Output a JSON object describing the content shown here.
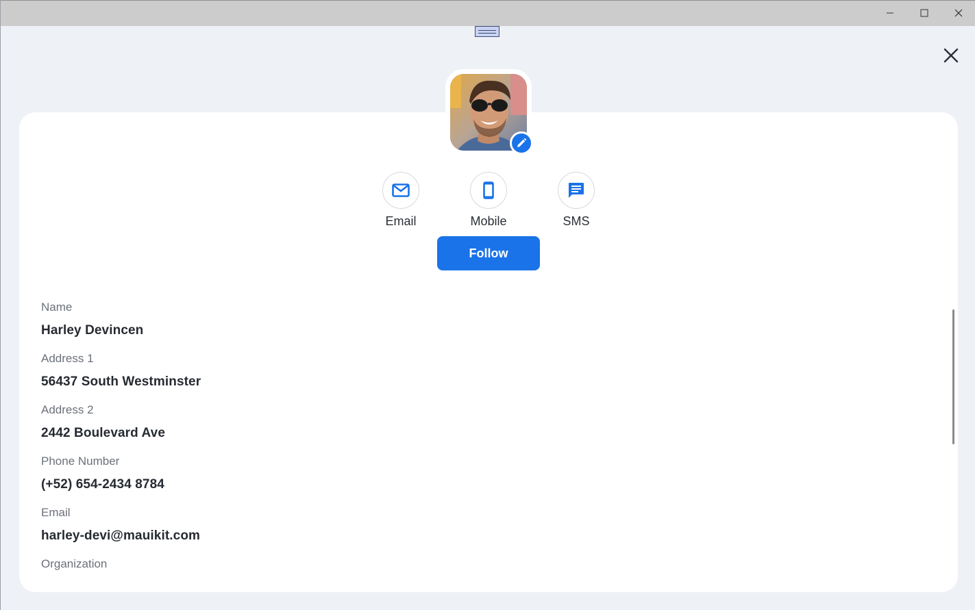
{
  "window": {
    "controls": {
      "minimize_icon": "minimize-icon",
      "maximize_icon": "maximize-icon",
      "close_icon": "close-icon"
    }
  },
  "header": {
    "close_icon": "close-icon"
  },
  "profile": {
    "avatar_description": "profile-photo",
    "edit_icon": "pencil-icon"
  },
  "actions": [
    {
      "label": "Email",
      "icon": "mail-icon"
    },
    {
      "label": "Mobile",
      "icon": "mobile-phone-icon"
    },
    {
      "label": "SMS",
      "icon": "message-icon"
    }
  ],
  "follow_button": {
    "label": "Follow"
  },
  "fields": [
    {
      "label": "Name",
      "value": "Harley Devincen"
    },
    {
      "label": "Address 1",
      "value": "56437 South Westminster"
    },
    {
      "label": "Address 2",
      "value": "2442 Boulevard Ave"
    },
    {
      "label": "Phone Number",
      "value": "(+52) 654-2434 8784"
    },
    {
      "label": "Email",
      "value": "harley-devi@mauikit.com"
    },
    {
      "label": "Organization",
      "value": ""
    }
  ],
  "colors": {
    "accent": "#1a73e8",
    "background": "#eef1f5",
    "card": "#ffffff",
    "titlebar": "#cccccc"
  }
}
